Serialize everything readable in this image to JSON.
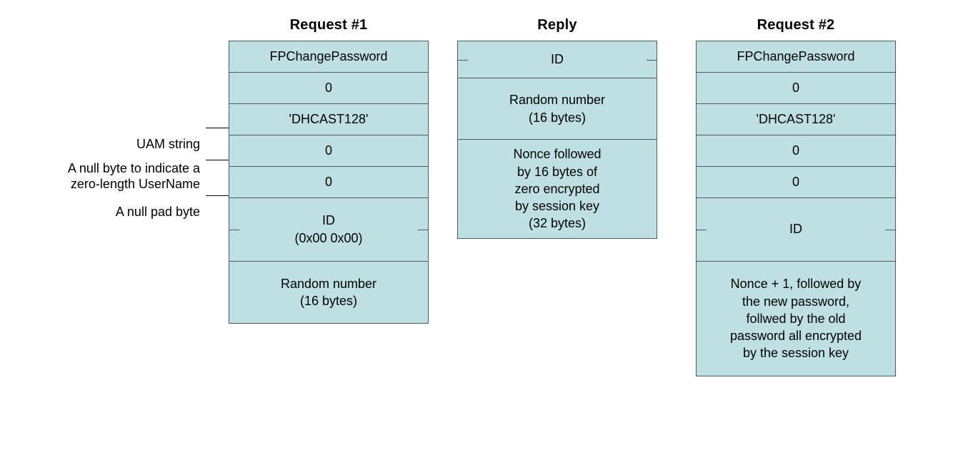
{
  "labels": {
    "uam": "UAM string",
    "nullByte": "A null byte to indicate a\nzero-length UserName",
    "nullPad": "A null pad byte"
  },
  "request1": {
    "title": "Request #1",
    "r0": "FPChangePassword",
    "r1": "0",
    "r2": "'DHCAST128'",
    "r3": "0",
    "r4": "0",
    "r5": "ID\n(0x00 0x00)",
    "r6": "Random number\n(16 bytes)"
  },
  "reply": {
    "title": "Reply",
    "r0": "ID",
    "r1": "Random number\n(16 bytes)",
    "r2": "Nonce followed\nby 16 bytes of\nzero encrypted\nby session key\n(32 bytes)"
  },
  "request2": {
    "title": "Request #2",
    "r0": "FPChangePassword",
    "r1": "0",
    "r2": "'DHCAST128'",
    "r3": "0",
    "r4": "0",
    "r5": "ID",
    "r6": "Nonce + 1, followed by\nthe new password,\nfollwed by the old\npassword all encrypted\nby the session key"
  }
}
